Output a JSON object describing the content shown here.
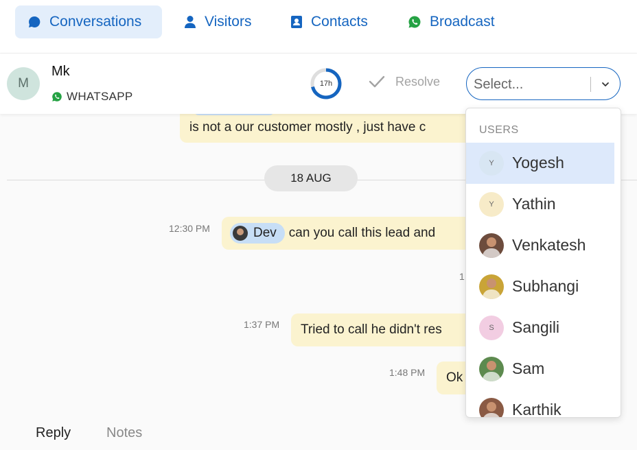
{
  "nav": {
    "tabs": [
      {
        "label": "Conversations",
        "icon": "chat-bubble-icon",
        "active": true
      },
      {
        "label": "Visitors",
        "icon": "person-icon"
      },
      {
        "label": "Contacts",
        "icon": "contact-book-icon"
      },
      {
        "label": "Broadcast",
        "icon": "whatsapp-icon"
      }
    ]
  },
  "conversation": {
    "avatar_letter": "M",
    "name": "Mk",
    "channel": "WHATSAPP",
    "timer_label": "17h",
    "resolve_label": "Resolve",
    "assign_placeholder": "Select..."
  },
  "messages": {
    "top_partial": "is not a our customer mostly , just have c",
    "date_separator": "18 AUG",
    "items": [
      {
        "time": "12:30 PM",
        "mention": "Dev",
        "text": "can you call this lead and"
      },
      {
        "time": "1:37 PM",
        "text": "Tried to call he didn't res"
      },
      {
        "time": "1:48 PM",
        "text": "Ok"
      }
    ],
    "partial_time_fragment": "1"
  },
  "reply": {
    "tabs": [
      "Reply",
      "Notes"
    ]
  },
  "dropdown": {
    "group_label": "USERS",
    "users": [
      {
        "name": "Yogesh",
        "initial": "Y",
        "avatar_color": "#d8e6f3",
        "highlighted": true
      },
      {
        "name": "Yathin",
        "initial": "Y",
        "avatar_color": "#f7ebc8"
      },
      {
        "name": "Venkatesh",
        "photo": true,
        "avatar_color": "#6d4c3d"
      },
      {
        "name": "Subhangi",
        "photo": true,
        "avatar_color": "#c9a437"
      },
      {
        "name": "Sangili",
        "initial": "S",
        "avatar_color": "#f2cde2"
      },
      {
        "name": "Sam",
        "photo": true,
        "avatar_color": "#5d8a4f"
      },
      {
        "name": "Karthik",
        "photo": true,
        "avatar_color": "#8a5a44"
      }
    ]
  },
  "colors": {
    "accent": "#1565c0",
    "bubble": "#fbf3cf",
    "whatsapp": "#25a244"
  }
}
